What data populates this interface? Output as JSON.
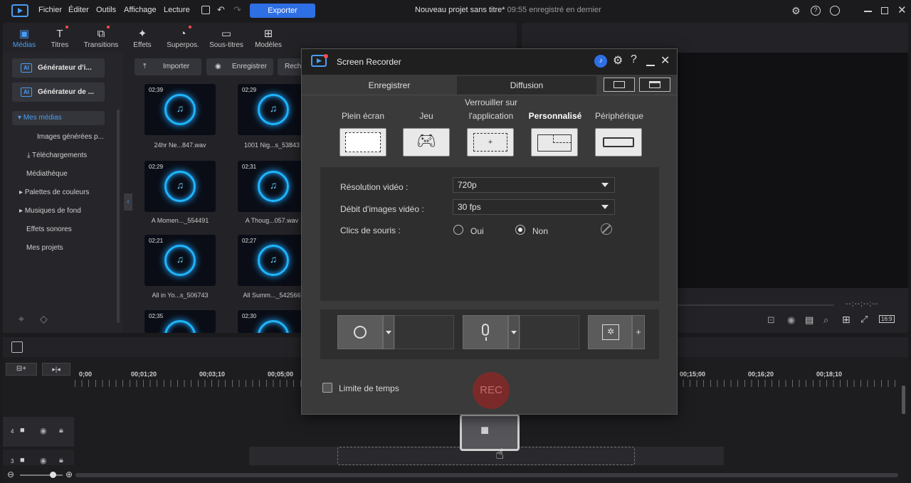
{
  "menu": [
    "Fichier",
    "Éditer",
    "Outils",
    "Affichage",
    "Lecture"
  ],
  "export_label": "Exporter",
  "window_title": "Nouveau projet sans titre*",
  "save_status": "09:55 enregistré en dernier",
  "tool_tabs": [
    "Médias",
    "Titres",
    "Transitions",
    "Effets",
    "Superpos.",
    "Sous-titres",
    "Modèles"
  ],
  "sidebar": {
    "gen1": "Générateur d'i...",
    "gen2": "Générateur de ...",
    "items": [
      "Mes médias",
      "Images générées p...",
      "Téléchargements",
      "Médiathèque",
      "Palettes de couleurs",
      "Musiques de fond",
      "Effets sonores",
      "Mes projets"
    ]
  },
  "media_toolbar": {
    "import": "Importer",
    "record": "Enregistrer",
    "search": "Rech"
  },
  "media_items": [
    {
      "duration": "02;39",
      "name": "24hr Ne...847.wav"
    },
    {
      "duration": "02;29",
      "name": "1001 Nig...s_53843"
    },
    {
      "duration": "02;29",
      "name": "A Momen..._554491"
    },
    {
      "duration": "02;31",
      "name": "A Thoug...057.wav"
    },
    {
      "duration": "02;21",
      "name": "All in Yo...s_506743"
    },
    {
      "duration": "02;27",
      "name": "All Summ..._542566"
    },
    {
      "duration": "02;35",
      "name": ""
    },
    {
      "duration": "02;30",
      "name": ""
    }
  ],
  "preview": {
    "timecode": "--;--;--;--",
    "aspect": "16:9"
  },
  "timeline": {
    "ticks_left": [
      "0;00",
      "00;01;20",
      "00;03;10",
      "00;05;00"
    ],
    "ticks_right": [
      "00;15;00",
      "00;16;20",
      "00;18;10"
    ],
    "tracks": [
      "4",
      "3"
    ]
  },
  "recorder": {
    "title": "Screen Recorder",
    "tabs": [
      "Enregistrer",
      "Diffusion"
    ],
    "modes": [
      "Plein écran",
      "Jeu",
      "Verrouiller sur l'application",
      "Personnalisé",
      "Périphérique"
    ],
    "resolution_label": "Résolution vidéo :",
    "resolution_value": "720p",
    "fps_label": "Débit d'images vidéo :",
    "fps_value": "30 fps",
    "clicks_label": "Clics de souris :",
    "oui": "Oui",
    "non": "Non",
    "time_limit": "Limite de temps",
    "rec": "REC"
  },
  "colors": {
    "accent": "#4a9cf5",
    "export": "#2f6fe4",
    "rec": "#7b2a2a"
  }
}
